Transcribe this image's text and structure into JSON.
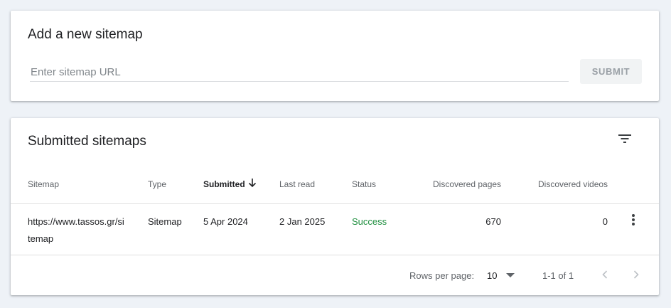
{
  "add_sitemap": {
    "title": "Add a new sitemap",
    "input_placeholder": "Enter sitemap URL",
    "input_value": "",
    "submit_label": "SUBMIT"
  },
  "submitted": {
    "title": "Submitted sitemaps",
    "columns": {
      "sitemap": "Sitemap",
      "type": "Type",
      "submitted": "Submitted",
      "last_read": "Last read",
      "status": "Status",
      "discovered_pages": "Discovered pages",
      "discovered_videos": "Discovered videos"
    },
    "rows": [
      {
        "sitemap_line1": "https://www.tassos.gr/si",
        "sitemap_line2": "temap",
        "type": "Sitemap",
        "submitted": "5 Apr 2024",
        "last_read": "2 Jan 2025",
        "status": "Success",
        "discovered_pages": "670",
        "discovered_videos": "0"
      }
    ],
    "pagination": {
      "rows_per_page_label": "Rows per page:",
      "rows_per_page_value": "10",
      "range_text": "1-1 of 1"
    }
  },
  "colors": {
    "page_background": "#eef2f7",
    "status_success": "#1e8e3e",
    "submit_disabled_bg": "#f1f3f4",
    "submit_disabled_text": "#9aa0a6"
  },
  "icons": {
    "filter": "filter-list-icon",
    "sort": "arrow-downward-icon",
    "more": "more-vert-icon",
    "dropdown": "arrow-drop-down-icon",
    "prev": "chevron-left-icon",
    "next": "chevron-right-icon"
  }
}
